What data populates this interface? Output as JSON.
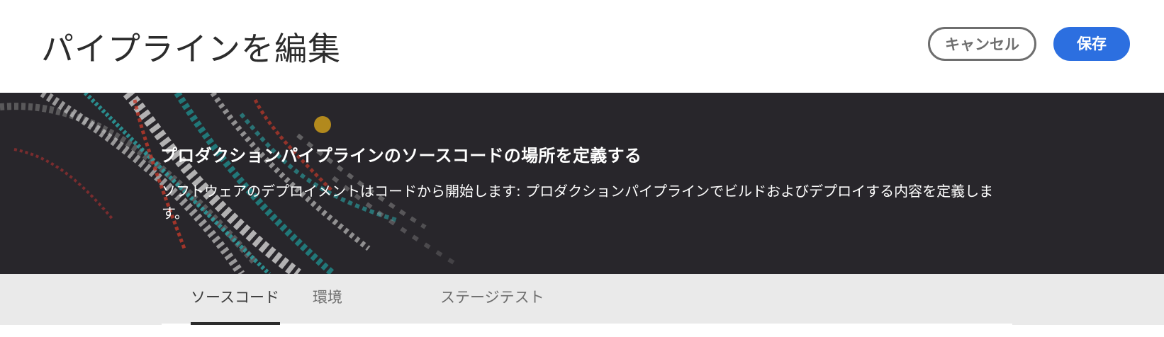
{
  "header": {
    "title": "パイプラインを編集",
    "cancel_label": "キャンセル",
    "save_label": "保存",
    "save_color": "#2c6fe0"
  },
  "banner": {
    "heading": "プロダクションパイプラインのソースコードの場所を定義する",
    "description": "ソフトウェアのデプロイメントはコードから開始します: プロダクションパイプラインでビルドおよびデプロイする内容を定義します。"
  },
  "tabs": [
    {
      "label": "ソースコード",
      "active": true
    },
    {
      "label": "環境",
      "active": false
    },
    {
      "label": "ステージテスト",
      "active": false
    }
  ]
}
